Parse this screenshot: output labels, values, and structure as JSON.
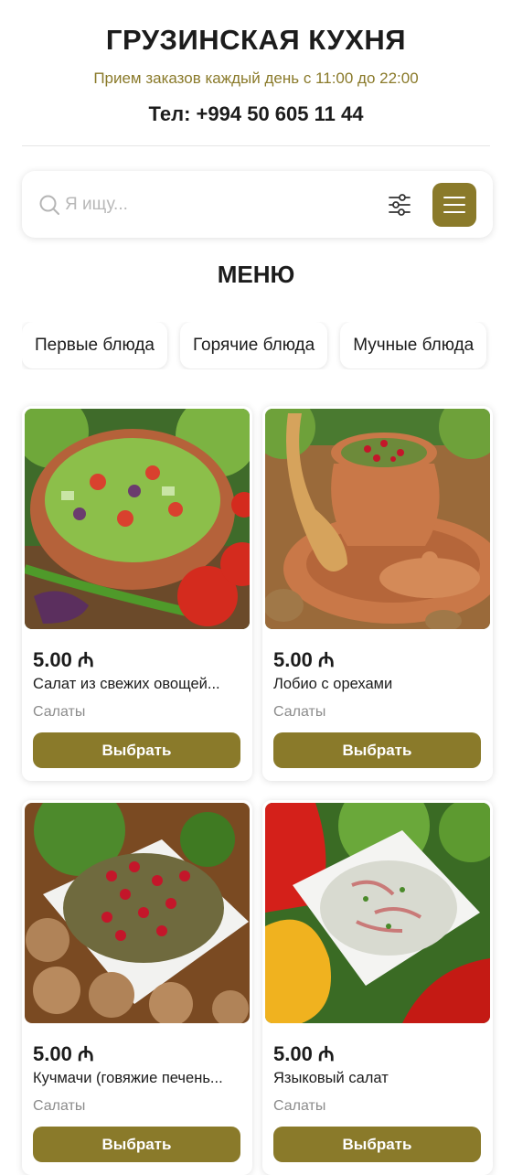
{
  "header": {
    "title": "ГРУЗИНСКАЯ КУХНЯ",
    "hours": "Прием заказов каждый день с 11:00 до 22:00",
    "phone": "Тел: +994 50 605 11 44"
  },
  "search": {
    "placeholder": "Я ищу...",
    "value": ""
  },
  "menu": {
    "title": "МЕНЮ",
    "categories": [
      "Первые блюда",
      "Горячие блюда",
      "Мучные блюда"
    ]
  },
  "products": [
    {
      "price": "5.00 ₼",
      "name": "Салат из свежих овощей...",
      "category": "Салаты",
      "button": "Выбрать",
      "image": "fresh-vegetable-salad-photo"
    },
    {
      "price": "5.00 ₼",
      "name": "Лобио с орехами",
      "category": "Салаты",
      "button": "Выбрать",
      "image": "lobio-clay-pot-photo"
    },
    {
      "price": "5.00 ₼",
      "name": "Кучмачи (говяжие печень...",
      "category": "Салаты",
      "button": "Выбрать",
      "image": "kuchmachi-walnut-photo"
    },
    {
      "price": "5.00 ₼",
      "name": "Языковый салат",
      "category": "Салаты",
      "button": "Выбрать",
      "image": "tongue-salad-photo"
    }
  ],
  "colors": {
    "accent": "#8a7a2a",
    "text": "#1c1c1c",
    "muted": "#8c8c8c"
  },
  "icons": [
    "search-icon",
    "filter-icon",
    "hamburger-menu-icon"
  ]
}
